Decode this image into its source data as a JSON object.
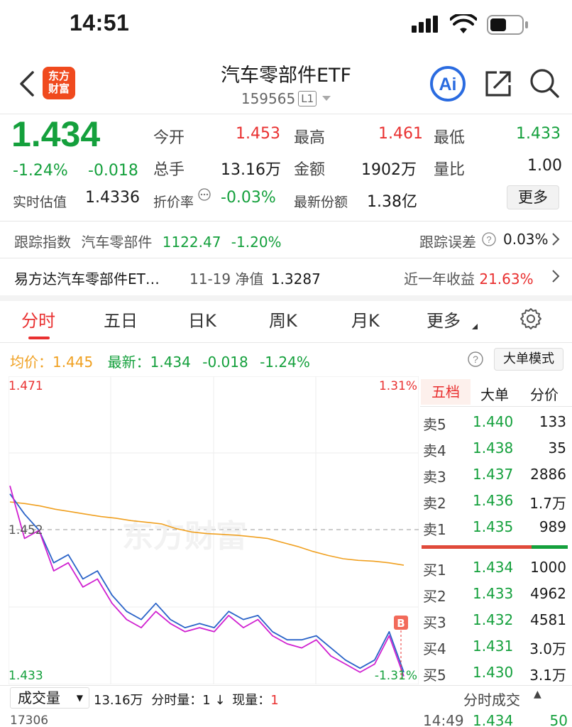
{
  "status_bar": {
    "time": "14:51"
  },
  "nav": {
    "logo_line1": "东方",
    "logo_line2": "财富",
    "title": "汽车零部件ETF",
    "code": "159565",
    "level_badge": "L1"
  },
  "quote": {
    "price": "1.434",
    "change_pct": "-1.24%",
    "change": "-0.018",
    "open_label": "今开",
    "open": "1.453",
    "high_label": "最高",
    "high": "1.461",
    "low_label": "最低",
    "low": "1.433",
    "volume_label": "总手",
    "volume": "13.16万",
    "amount_label": "金额",
    "amount": "1902万",
    "vol_ratio_label": "量比",
    "vol_ratio": "1.00",
    "iopv_label": "实时估值",
    "iopv": "1.4336",
    "discount_label": "折价率",
    "discount": "-0.03%",
    "shares_label": "最新份额",
    "shares": "1.38亿",
    "more_label": "更多"
  },
  "tracking": {
    "label": "跟踪指数",
    "index_name": "汽车零部件",
    "index_value": "1122.47",
    "index_change": "-1.20%",
    "error_label": "跟踪误差",
    "error_value": "0.03%"
  },
  "fund": {
    "name": "易方达汽车零部件ET…",
    "nav_label": "11-19 净值",
    "nav": "1.3287",
    "return_label": "近一年收益",
    "return_value": "21.63%"
  },
  "tabs": [
    "分时",
    "五日",
    "日K",
    "周K",
    "月K",
    "更多"
  ],
  "chart_header": {
    "avg_label": "均价：",
    "avg": "1.445",
    "latest_label": "最新：",
    "latest": "1.434",
    "latest_change": "-0.018",
    "latest_pct": "-1.24%",
    "mode_label": "大单模式"
  },
  "chart_labels": {
    "top_left": "1.471",
    "top_right": "1.31%",
    "mid_left": "1.452",
    "bottom_left": "1.433",
    "bottom_right": "-1.31%",
    "b_marker": "B",
    "watermark": "东方财富"
  },
  "chart_data": {
    "type": "line",
    "ylim": [
      1.433,
      1.471
    ],
    "reference": 1.452,
    "series": [
      {
        "name": "均价",
        "color": "#f0a020",
        "values": [
          1.4555,
          1.4553,
          1.455,
          1.4546,
          1.4543,
          1.454,
          1.4537,
          1.4535,
          1.4532,
          1.453,
          1.4528,
          1.4522,
          1.4518,
          1.4516,
          1.4515,
          1.4514,
          1.4512,
          1.451,
          1.4505,
          1.45,
          1.4494,
          1.4489,
          1.4485,
          1.4483,
          1.4482,
          1.448,
          1.4477
        ]
      },
      {
        "name": "price",
        "color": "#2a63c8",
        "values": [
          1.4565,
          1.454,
          1.452,
          1.448,
          1.449,
          1.446,
          1.447,
          1.444,
          1.442,
          1.441,
          1.443,
          1.441,
          1.44,
          1.4405,
          1.44,
          1.442,
          1.441,
          1.4415,
          1.4395,
          1.4385,
          1.4385,
          1.439,
          1.4375,
          1.436,
          1.435,
          1.436,
          1.4395,
          1.4345
        ]
      },
      {
        "name": "series-2",
        "color": "#d020d0",
        "values": [
          1.4575,
          1.451,
          1.452,
          1.447,
          1.448,
          1.445,
          1.446,
          1.443,
          1.441,
          1.44,
          1.442,
          1.4405,
          1.4395,
          1.44,
          1.4395,
          1.4415,
          1.44,
          1.441,
          1.439,
          1.438,
          1.4375,
          1.4385,
          1.4365,
          1.4355,
          1.4345,
          1.4355,
          1.439,
          1.434
        ]
      }
    ]
  },
  "orderbook": {
    "tabs": [
      "五档",
      "大单",
      "分价"
    ],
    "asks": [
      {
        "label": "卖5",
        "price": "1.440",
        "qty": "133"
      },
      {
        "label": "卖4",
        "price": "1.438",
        "qty": "35"
      },
      {
        "label": "卖3",
        "price": "1.437",
        "qty": "2886"
      },
      {
        "label": "卖2",
        "price": "1.436",
        "qty": "1.7万"
      },
      {
        "label": "卖1",
        "price": "1.435",
        "qty": "989"
      }
    ],
    "bids": [
      {
        "label": "买1",
        "price": "1.434",
        "qty": "1000"
      },
      {
        "label": "买2",
        "price": "1.433",
        "qty": "4962"
      },
      {
        "label": "买3",
        "price": "1.432",
        "qty": "4581"
      },
      {
        "label": "买4",
        "price": "1.431",
        "qty": "3.0万"
      },
      {
        "label": "买5",
        "price": "1.430",
        "qty": "3.1万"
      }
    ],
    "sell_ratio": 0.75
  },
  "volume_bar": {
    "select_label": "成交量",
    "total": "13.16万",
    "tick_label": "分时量：",
    "tick_value": "1",
    "cur_label": "现量：",
    "cur_value": "1",
    "axis_value": "17306"
  },
  "trades": {
    "header": "分时成交",
    "rows": [
      {
        "time": "14:49",
        "price": "1.434",
        "qty": "50"
      }
    ]
  }
}
